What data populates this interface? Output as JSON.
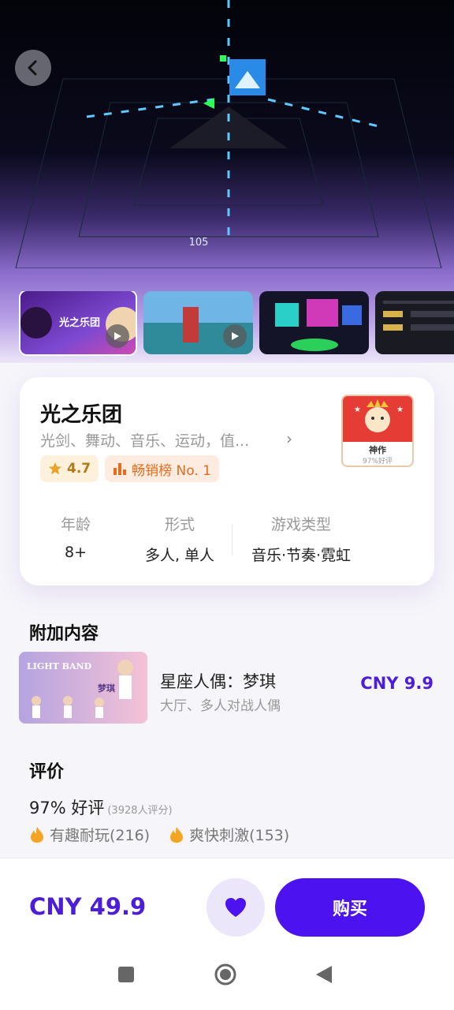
{
  "game": {
    "title": "光之乐团",
    "tags": "光剑、舞动、音乐、运动，值...",
    "rating": "4.7",
    "rank_label": "畅销榜 No. 1",
    "award_title": "神作",
    "award_sub": "97%好评"
  },
  "hero": {
    "score_text": "105"
  },
  "info": [
    {
      "label": "年龄",
      "value": "8+"
    },
    {
      "label": "形式",
      "value": "多人, 单人"
    },
    {
      "label": "游戏类型",
      "value": "音乐·节奏·霓虹"
    }
  ],
  "screenshots": [
    {
      "title": "光之乐团"
    }
  ],
  "dlc": {
    "section_title": "附加内容",
    "thumb_text": "LIGHT BAND",
    "thumb_name": "梦琪",
    "name": "星座人偶：梦琪",
    "desc": "大厅、多人对战人偶",
    "price": "CNY 9.9"
  },
  "reviews": {
    "section_title": "评价",
    "score": "97% 好评",
    "count": "(3928人评分)",
    "tags": [
      {
        "label": "有趣耐玩(216)"
      },
      {
        "label": "爽快刺激(153)"
      }
    ]
  },
  "purchase": {
    "price": "CNY 49.9",
    "buy_label": "购买"
  },
  "colors": {
    "accent": "#4d12f0",
    "price": "#4d1ed8",
    "rating": "#b07a18",
    "rank": "#e36c1e",
    "award": "#e53c35"
  }
}
